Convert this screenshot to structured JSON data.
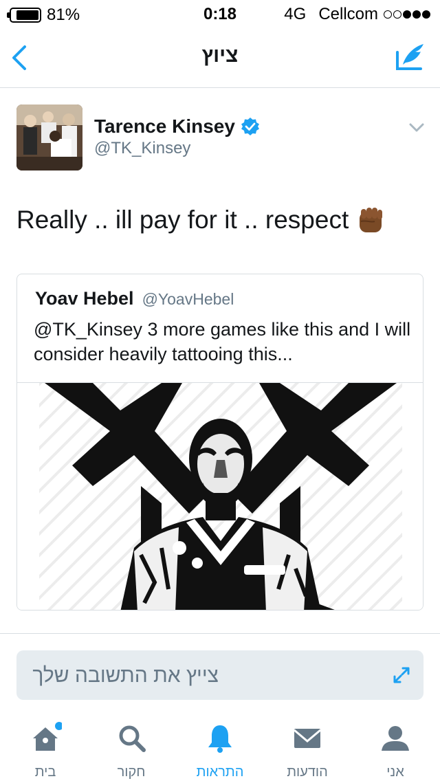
{
  "status_bar": {
    "battery_percent": "81%",
    "time": "0:18",
    "network": "4G",
    "carrier": "Cellcom",
    "signal_bars_filled": 3,
    "signal_bars_total": 5
  },
  "nav": {
    "title": "ציוץ",
    "back_icon": "chevron-left-icon",
    "compose_icon": "compose-tweet-icon"
  },
  "tweet": {
    "author_name": "Tarence Kinsey",
    "author_handle": "@TK_Kinsey",
    "verified": true,
    "text": "Really .. ill pay for it .. respect",
    "emoji": "fist-emoji-icon"
  },
  "quoted_tweet": {
    "author_name": "Yoav Hebel",
    "author_handle": "@YoavHebel",
    "text": "@TK_Kinsey 3 more games like this and I will consider heavily tattooing this..."
  },
  "reply": {
    "placeholder": "צייץ את התשובה שלך"
  },
  "tabs": [
    {
      "label": "בית",
      "icon": "home-icon",
      "active": false,
      "has_notification_dot": true
    },
    {
      "label": "חקור",
      "icon": "search-icon",
      "active": false
    },
    {
      "label": "התראות",
      "icon": "bell-icon",
      "active": true
    },
    {
      "label": "הודעות",
      "icon": "envelope-icon",
      "active": false
    },
    {
      "label": "אני",
      "icon": "person-icon",
      "active": false
    }
  ],
  "colors": {
    "accent": "#1da1f2",
    "text_primary": "#14171a",
    "text_secondary": "#657786",
    "divider": "#d8dde1",
    "reply_bg": "#e6ecf0"
  }
}
